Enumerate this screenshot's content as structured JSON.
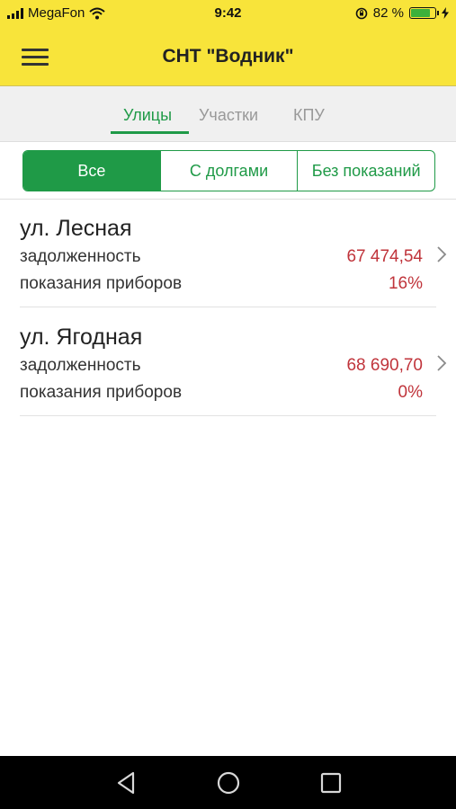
{
  "status_bar": {
    "carrier": "MegaFon",
    "time": "9:42",
    "battery_percent": "82 %",
    "battery_level": 0.82,
    "icons": [
      "signal-icon",
      "wifi-icon",
      "rotation-lock-icon",
      "battery-icon",
      "charging-icon"
    ]
  },
  "app_bar": {
    "title": "СНТ \"Водник\"",
    "menu_icon": "hamburger-menu-icon"
  },
  "tabs": [
    {
      "label": "Улицы",
      "active": true
    },
    {
      "label": "Участки",
      "active": false
    },
    {
      "label": "КПУ",
      "active": false
    }
  ],
  "filter": [
    {
      "label": "Все",
      "active": true
    },
    {
      "label": "С долгами",
      "active": false
    },
    {
      "label": "Без показаний",
      "active": false
    }
  ],
  "streets": [
    {
      "name": "ул. Лесная",
      "debt_label": "задолженность",
      "debt_value": "67 474,54",
      "readings_label": "показания приборов",
      "readings_value": "16%"
    },
    {
      "name": "ул. Ягодная",
      "debt_label": "задолженность",
      "debt_value": "68 690,70",
      "readings_label": "показания приборов",
      "readings_value": "0%"
    }
  ],
  "colors": {
    "header_bg": "#f8e43a",
    "accent_green": "#1f9a47",
    "value_red": "#c0343b",
    "nav_bg": "#000000"
  },
  "nav_bar": [
    "back-icon",
    "home-icon",
    "recents-icon"
  ]
}
